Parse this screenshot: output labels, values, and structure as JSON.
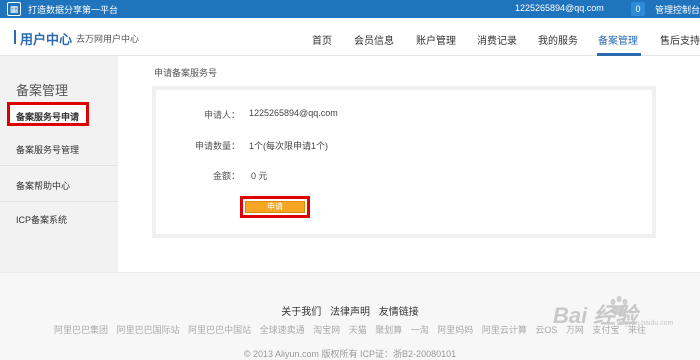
{
  "topbar": {
    "platform": "打造数据分享第一平台",
    "user": "1225265894@qq.com",
    "notify_count": "0",
    "console": "管理控制台"
  },
  "header": {
    "title": "用户中心",
    "subtitle": "去万网用户中心",
    "nav": [
      "首页",
      "会员信息",
      "账户管理",
      "消费记录",
      "我的服务",
      "备案管理",
      "售后支持"
    ],
    "active_nav": "备案管理"
  },
  "sidebar": {
    "title": "备案管理",
    "items": [
      "备案服务号申请",
      "备案服务号管理",
      "备案帮助中心",
      "ICP备案系统"
    ]
  },
  "content": {
    "breadcrumb": "申请备案服务号",
    "applicant_label": "申请人：",
    "applicant_value": "1225265894@qq.com",
    "quantity_label": "申请数量：",
    "quantity_value": "1个(每次限申请1个)",
    "amount_label": "金额：",
    "amount_value": "0 元",
    "apply_button": "申请"
  },
  "footer": {
    "links": [
      "关于我们",
      "法律声明",
      "友情链接"
    ],
    "partners": [
      "阿里巴巴集团",
      "阿里巴巴国际站",
      "阿里巴巴中国站",
      "全球速卖通",
      "淘宝网",
      "天猫",
      "聚划算",
      "一淘",
      "阿里妈妈",
      "阿里云计算",
      "云OS",
      "万网",
      "支付宝",
      "来往"
    ],
    "copyright": "© 2013 Aliyun.com 版权所有 ICP证：浙B2-20080101"
  },
  "watermark": {
    "brand": "Bai 经验",
    "site": "jingyan.baidu.com"
  },
  "colors": {
    "topbar": "#1f74bd",
    "accent": "#2b6cb0",
    "highlight_box": "#e00000",
    "button": "#f6a623"
  }
}
